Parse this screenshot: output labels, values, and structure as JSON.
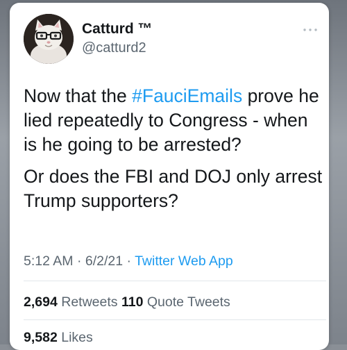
{
  "author": {
    "display_name": "Catturd ™",
    "handle": "@catturd2"
  },
  "icons": {
    "avatar": "cat-with-glasses-avatar",
    "more": "more-options-icon"
  },
  "tweet": {
    "p1_before": "Now that the ",
    "hashtag": "#FauciEmails",
    "p1_after": " prove he lied repeatedly to Congress - when is he going to be arrested?",
    "p2": "Or does the FBI and DOJ only arrest Trump supporters?"
  },
  "meta": {
    "time": "5:12 AM",
    "separator": " · ",
    "date": "6/2/21",
    "source": "Twitter Web App"
  },
  "stats": {
    "retweets_count": "2,694",
    "retweets_label": "Retweets",
    "quotes_count": "110",
    "quotes_label": "Quote Tweets",
    "likes_count": "9,582",
    "likes_label": "Likes"
  },
  "colors": {
    "link": "#1d9bf0",
    "secondary_text": "#5b6670",
    "primary_text": "#14171a"
  }
}
